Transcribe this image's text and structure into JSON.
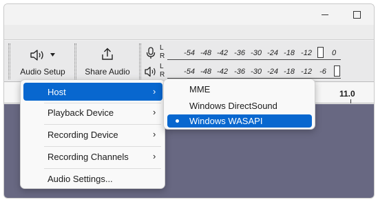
{
  "toolbar": {
    "audio_setup_label": "Audio Setup",
    "share_audio_label": "Share Audio"
  },
  "meters": {
    "record": {
      "channels": [
        "L",
        "R"
      ],
      "ticks": [
        "-54",
        "-48",
        "-42",
        "-36",
        "-30",
        "-24",
        "-18",
        "-12",
        "0"
      ]
    },
    "playback": {
      "channels": [
        "L",
        "R"
      ],
      "ticks": [
        "-54",
        "-48",
        "-42",
        "-36",
        "-30",
        "-24",
        "-18",
        "-12",
        "-6"
      ]
    }
  },
  "timeline": {
    "visible_time": "11.0"
  },
  "audio_setup_menu": {
    "items": [
      {
        "label": "Host"
      },
      {
        "label": "Playback Device"
      },
      {
        "label": "Recording Device"
      },
      {
        "label": "Recording Channels"
      },
      {
        "label": "Audio Settings..."
      }
    ],
    "selected": "Host"
  },
  "host_submenu": {
    "items": [
      {
        "label": "MME"
      },
      {
        "label": "Windows DirectSound"
      },
      {
        "label": "Windows WASAPI"
      }
    ],
    "selected": "Windows WASAPI"
  },
  "colors": {
    "accent": "#0867cf",
    "track_background": "#686882"
  },
  "icons": [
    "speaker-icon",
    "dropdown-caret-icon",
    "share-icon",
    "microphone-icon",
    "chevron-right-icon",
    "radio-bullet-icon"
  ]
}
